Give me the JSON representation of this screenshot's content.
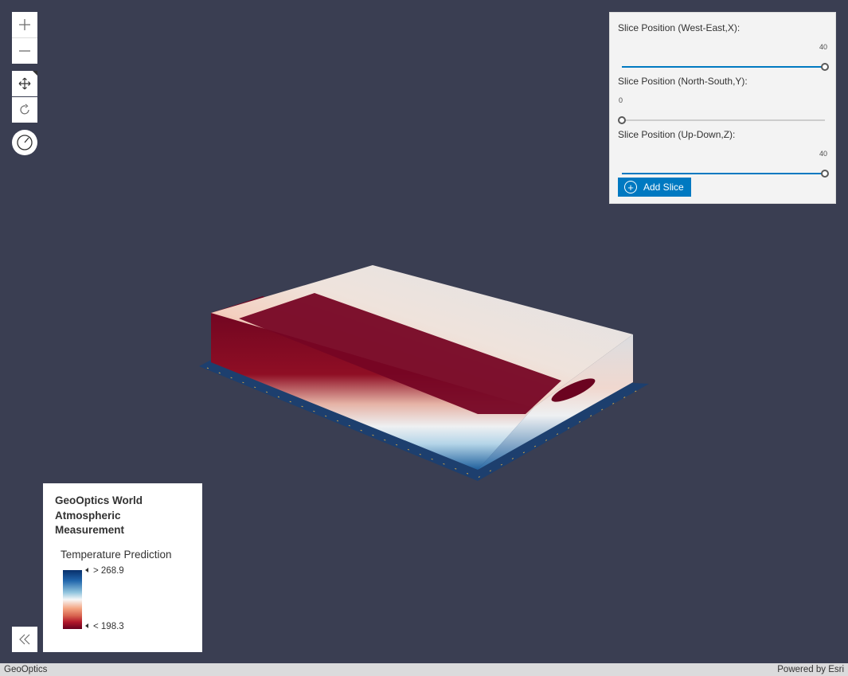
{
  "navigation": {
    "zoom_in_icon": "plus-icon",
    "zoom_out_icon": "minus-icon",
    "pan_icon": "move-arrows-icon",
    "rotate_icon": "rotate-icon",
    "compass_icon": "compass-icon"
  },
  "slice_panel": {
    "sliders": [
      {
        "label": "Slice Position (West-East,X):",
        "value": "40",
        "fraction": 1.0
      },
      {
        "label": "Slice Position (North-South,Y):",
        "value": "0",
        "fraction": 0.0
      },
      {
        "label": "Slice Position (Up-Down,Z):",
        "value": "40",
        "fraction": 1.0
      }
    ],
    "add_button_label": "Add Slice",
    "add_button_icon": "plus-circle-icon"
  },
  "legend": {
    "title": "GeoOptics World Atmospheric Measurement",
    "field": "Temperature Prediction",
    "max_label": "> 268.9",
    "min_label": "< 198.3",
    "colors": {
      "high": "#08306b",
      "mid": "#f7f7f7",
      "low": "#67001f"
    }
  },
  "collapse_icon": "double-chevron-left-icon",
  "attribution": {
    "left": "GeoOptics",
    "right": "Powered by Esri"
  },
  "colors": {
    "background": "#3a3e52",
    "accent": "#0079c1"
  }
}
